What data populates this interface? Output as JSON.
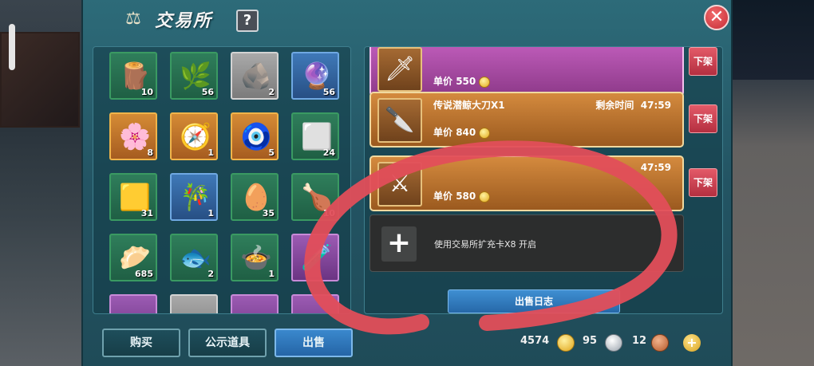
{
  "window": {
    "title": "交易所",
    "help_label": "?",
    "close_label": "✕"
  },
  "inventory": {
    "items": [
      {
        "icon": "tree-stump-icon",
        "glyph": "🪵",
        "count": "10",
        "rarity": "green"
      },
      {
        "icon": "branch-icon",
        "glyph": "🌿",
        "count": "56",
        "rarity": "green"
      },
      {
        "icon": "ore-icon",
        "glyph": "🪨",
        "count": "2",
        "rarity": "grey"
      },
      {
        "icon": "orb-icon",
        "glyph": "🔮",
        "count": "56",
        "rarity": "blue"
      },
      {
        "icon": "flower-icon",
        "glyph": "🌸",
        "count": "8",
        "rarity": "gold"
      },
      {
        "icon": "compass-icon",
        "glyph": "🧭",
        "count": "1",
        "rarity": "gold"
      },
      {
        "icon": "eye-medallion-icon",
        "glyph": "🧿",
        "count": "5",
        "rarity": "gold"
      },
      {
        "icon": "silver-ingot-icon",
        "glyph": "⬜",
        "count": "24",
        "rarity": "green"
      },
      {
        "icon": "gold-ingot-icon",
        "glyph": "🟨",
        "count": "31",
        "rarity": "green"
      },
      {
        "icon": "bamboo-shoot-icon",
        "glyph": "🎋",
        "count": "1",
        "rarity": "blue"
      },
      {
        "icon": "egg-icon",
        "glyph": "🥚",
        "count": "35",
        "rarity": "green"
      },
      {
        "icon": "drumstick-icon",
        "glyph": "🍗",
        "count": "10",
        "rarity": "green"
      },
      {
        "icon": "dumpling-steamer-icon",
        "glyph": "🥟",
        "count": "685",
        "rarity": "green"
      },
      {
        "icon": "fish-dish-icon",
        "glyph": "🐟",
        "count": "2",
        "rarity": "green"
      },
      {
        "icon": "soup-bowl-icon",
        "glyph": "🍲",
        "count": "1",
        "rarity": "green"
      },
      {
        "icon": "potion-icon",
        "glyph": "🧪",
        "count": "",
        "rarity": "purple"
      },
      {
        "icon": "item-icon",
        "glyph": "",
        "count": "",
        "rarity": "purple"
      },
      {
        "icon": "scroll-icon",
        "glyph": "",
        "count": "",
        "rarity": "grey"
      },
      {
        "icon": "item-icon",
        "glyph": "",
        "count": "",
        "rarity": "purple"
      },
      {
        "icon": "item-icon",
        "glyph": "",
        "count": "",
        "rarity": "purple"
      }
    ]
  },
  "tabs": {
    "buy": "购买",
    "show": "公示道具",
    "sell": "出售"
  },
  "listings": [
    {
      "name": "",
      "price_label": "单价",
      "price": "550",
      "time_label": "",
      "time": "",
      "style": "pink",
      "delist": "下架"
    },
    {
      "name": "传说潜鲸大刀X1",
      "price_label": "单价",
      "price": "840",
      "time_label": "剩余时间",
      "time": "47:59",
      "style": "orange",
      "delist": "下架"
    },
    {
      "name": "",
      "price_label": "单价",
      "price": "580",
      "time_label": "",
      "time": "47:59",
      "style": "orange",
      "delist": "下架"
    }
  ],
  "expansion": {
    "text": "使用交易所扩充卡X8 开启",
    "plus": "+"
  },
  "sale_log_label": "出售日志",
  "currency": {
    "gold": "4574",
    "silver": "95",
    "bronze": "12",
    "add": "+"
  },
  "colors": {
    "annotation": "#e14e5a",
    "panel": "#2d6b79"
  }
}
